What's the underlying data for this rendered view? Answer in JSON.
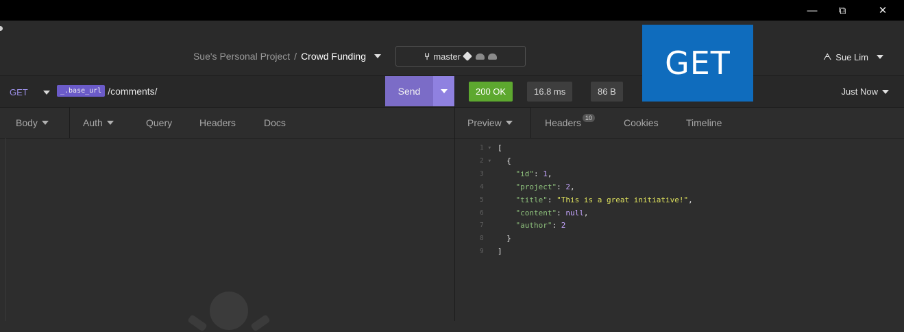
{
  "window": {
    "minimize_glyph": "—",
    "restore_glyph": "⧉",
    "close_glyph": "✕"
  },
  "header": {
    "project": "Sue's Personal Project",
    "separator": "/",
    "collection": "Crowd Funding",
    "branch": "master",
    "user": "Sue Lim"
  },
  "overlay_badge": "GET",
  "request": {
    "method": "GET",
    "base_tag": "_.base_url",
    "path": "/comments/",
    "send_label": "Send"
  },
  "request_tabs": [
    "Body",
    "Auth",
    "Query",
    "Headers",
    "Docs"
  ],
  "response": {
    "status": "200 OK",
    "time": "16.8 ms",
    "size": "86 B",
    "history": "Just Now"
  },
  "response_tabs": {
    "preview": "Preview",
    "headers": "Headers",
    "headers_count": "10",
    "cookies": "Cookies",
    "timeline": "Timeline"
  },
  "code_lines": [
    {
      "n": "1 ▾",
      "t": "["
    },
    {
      "n": "2 ▾",
      "t": "  {"
    },
    {
      "n": "3",
      "k": "\"id\"",
      "v": "1",
      "vt": "n"
    },
    {
      "n": "4",
      "k": "\"project\"",
      "v": "2",
      "vt": "n"
    },
    {
      "n": "5",
      "k": "\"title\"",
      "v": "\"This is a great initiative!\"",
      "vt": "s"
    },
    {
      "n": "6",
      "k": "\"content\"",
      "v": "null",
      "vt": "n"
    },
    {
      "n": "7",
      "k": "\"author\"",
      "v": "2",
      "vt": "n",
      "last": true
    },
    {
      "n": "8",
      "t": "  }"
    },
    {
      "n": "9",
      "t": "]"
    }
  ],
  "colors": {
    "accent": "#7b6cc7",
    "status_ok": "#5da82f",
    "overlay": "#0f6cbd"
  }
}
